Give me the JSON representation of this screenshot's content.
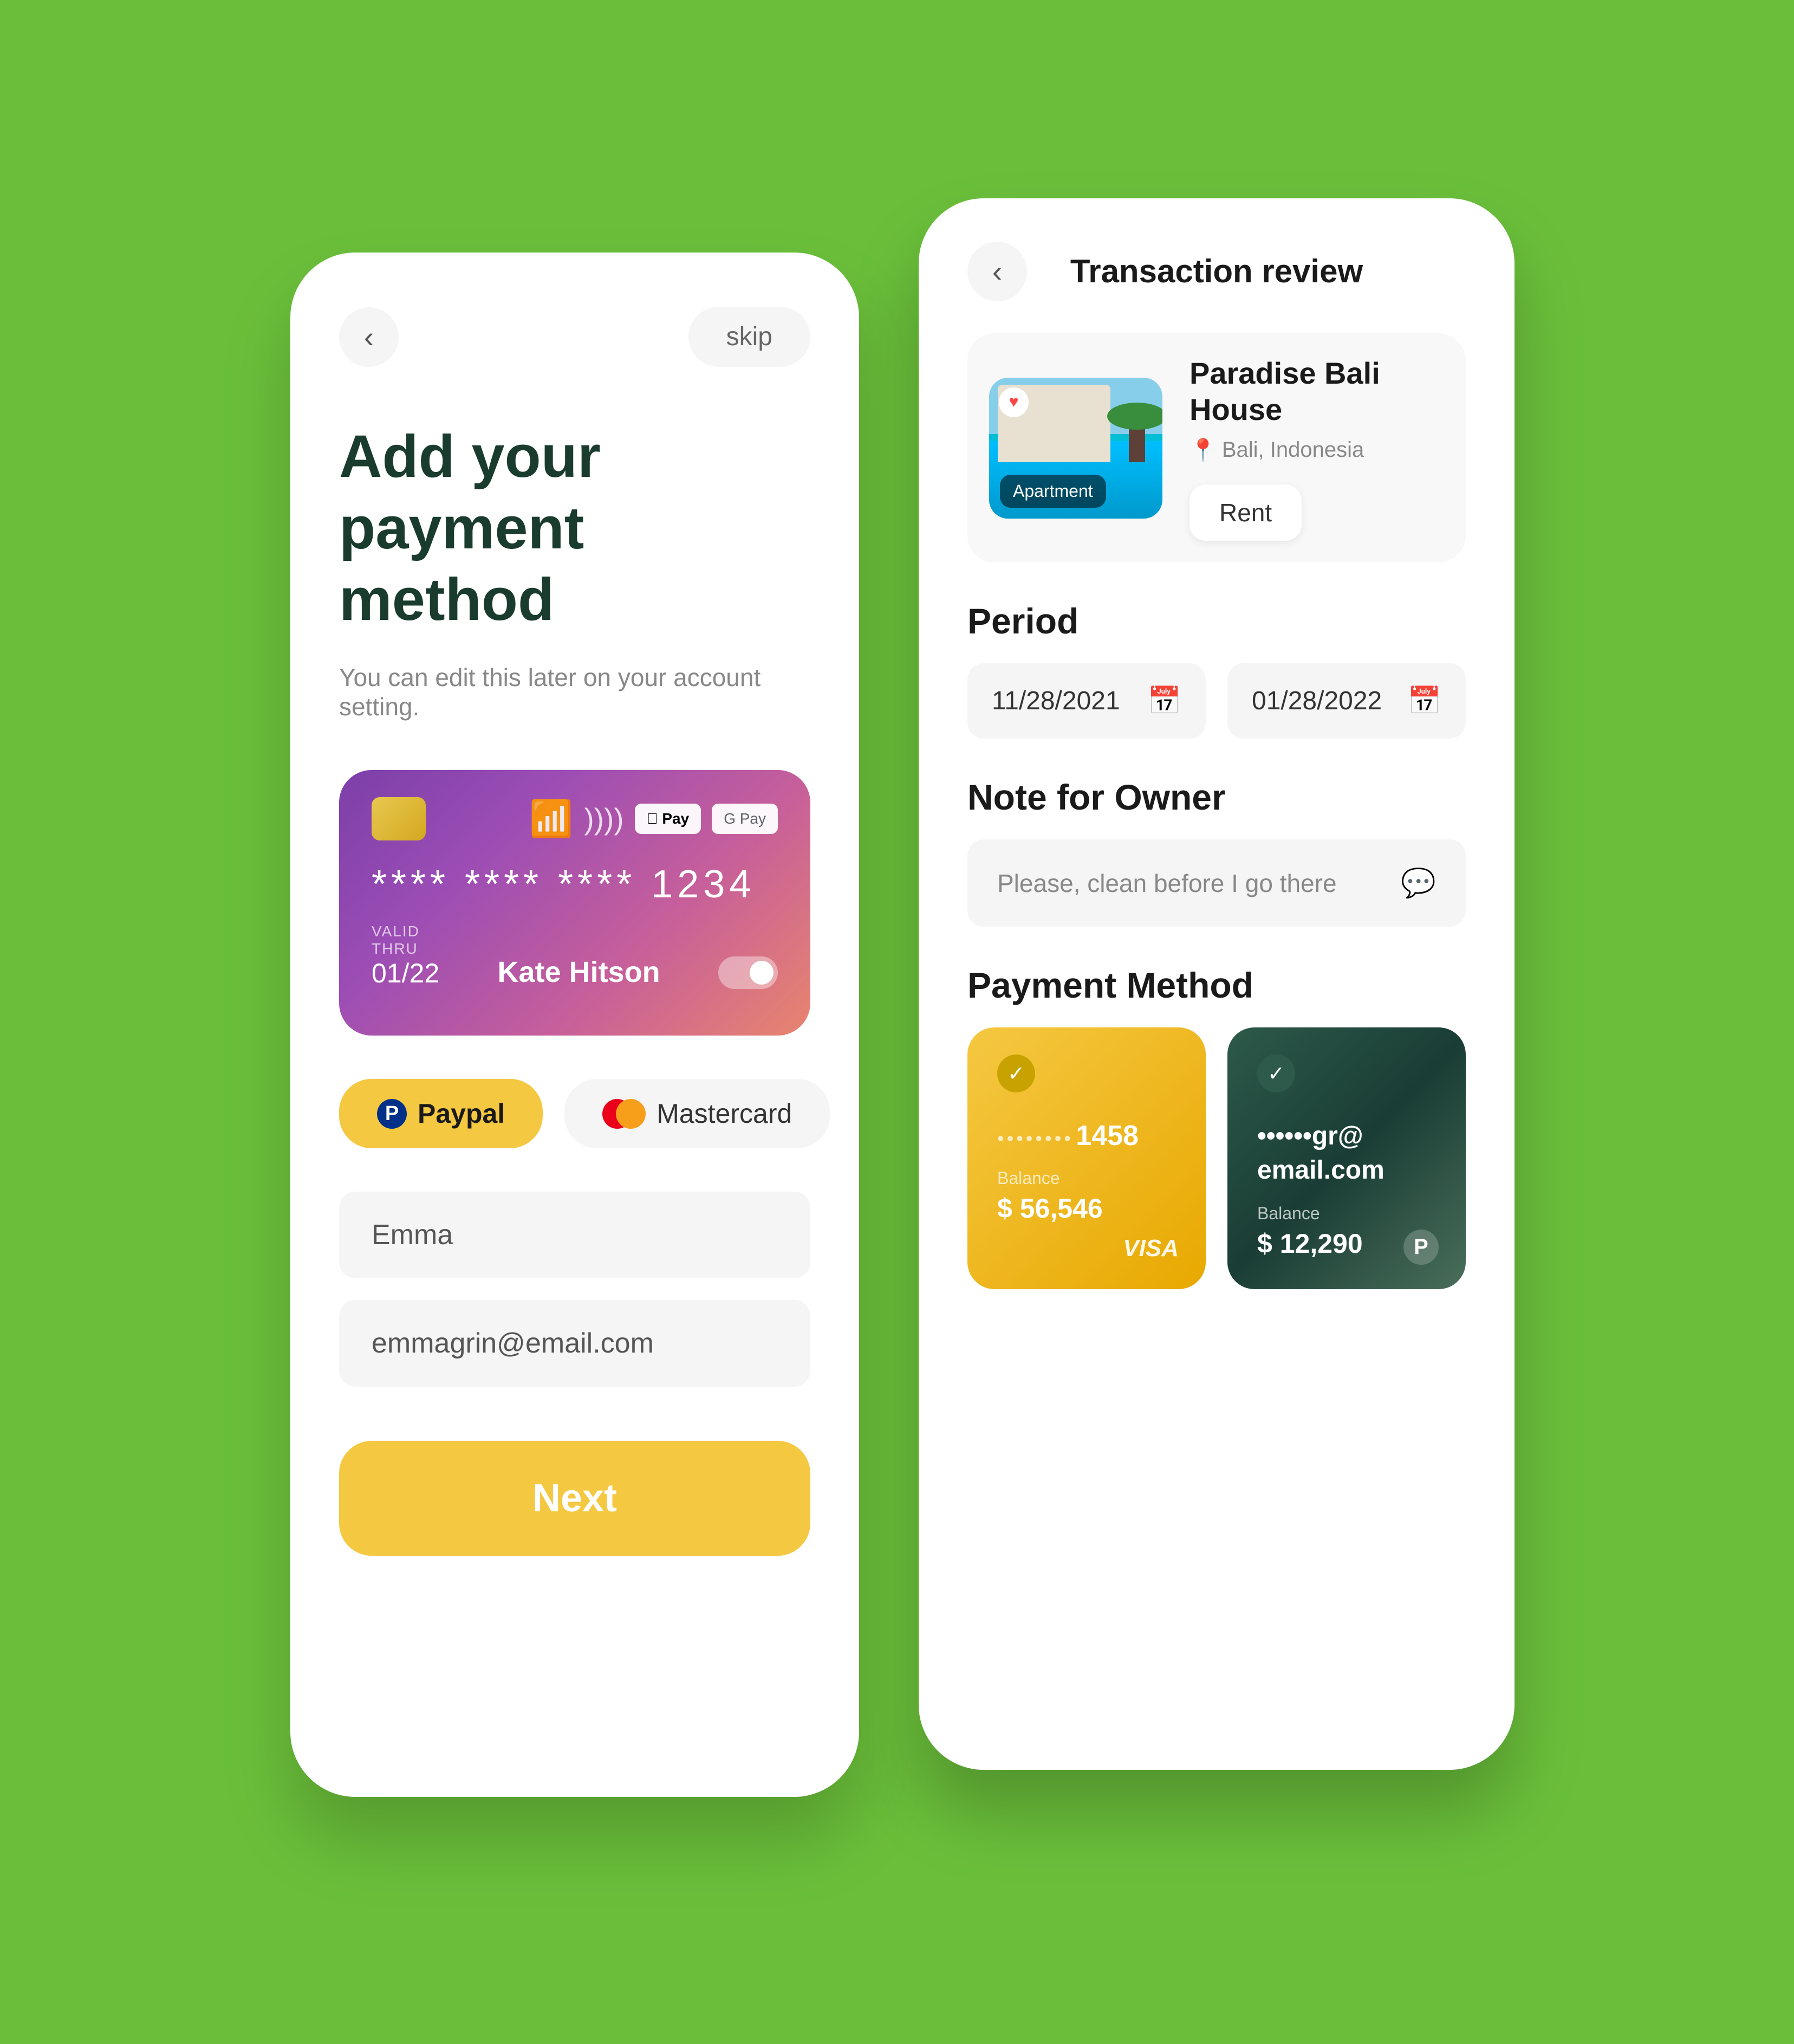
{
  "background_color": "#6abf3a",
  "phone_left": {
    "back_button_label": "‹",
    "skip_label": "skip",
    "title_line1": "Add your",
    "title_line2": "payment method",
    "subtitle": "You can edit this later on your account setting.",
    "credit_card": {
      "number": "**** **** **** 1234",
      "valid_thru_label": "VALID\nTHRU",
      "valid_date": "01/22",
      "card_holder": "Kate Hitson",
      "apple_pay": "Pay",
      "google_pay": "GPay"
    },
    "paypal_label": "Paypal",
    "mastercard_label": "Mastercard",
    "name_placeholder": "Emma",
    "email_placeholder": "emmagrin@email.com",
    "next_label": "Next"
  },
  "phone_right": {
    "back_button_label": "‹",
    "screen_title": "Transaction review",
    "property": {
      "name": "Paradise Bali House",
      "location": "Bali, Indonesia",
      "category": "Apartment",
      "transaction_type": "Rent"
    },
    "period_section_title": "Period",
    "date_start": "11/28/2021",
    "date_end": "01/28/2022",
    "note_section_title": "Note for Owner",
    "note_placeholder": "Please, clean before I go there",
    "payment_method_title": "Payment Method",
    "card_visa": {
      "dots": "••••••••",
      "number_end": "1458",
      "balance_label": "Balance",
      "balance_amount": "$ 56,546",
      "brand": "VISA"
    },
    "card_paypal": {
      "dots": "••••••",
      "email_suffix": "gr@\nemail.com",
      "balance_label": "Balance",
      "balance_amount": "$ 12,290",
      "brand": "P"
    }
  }
}
